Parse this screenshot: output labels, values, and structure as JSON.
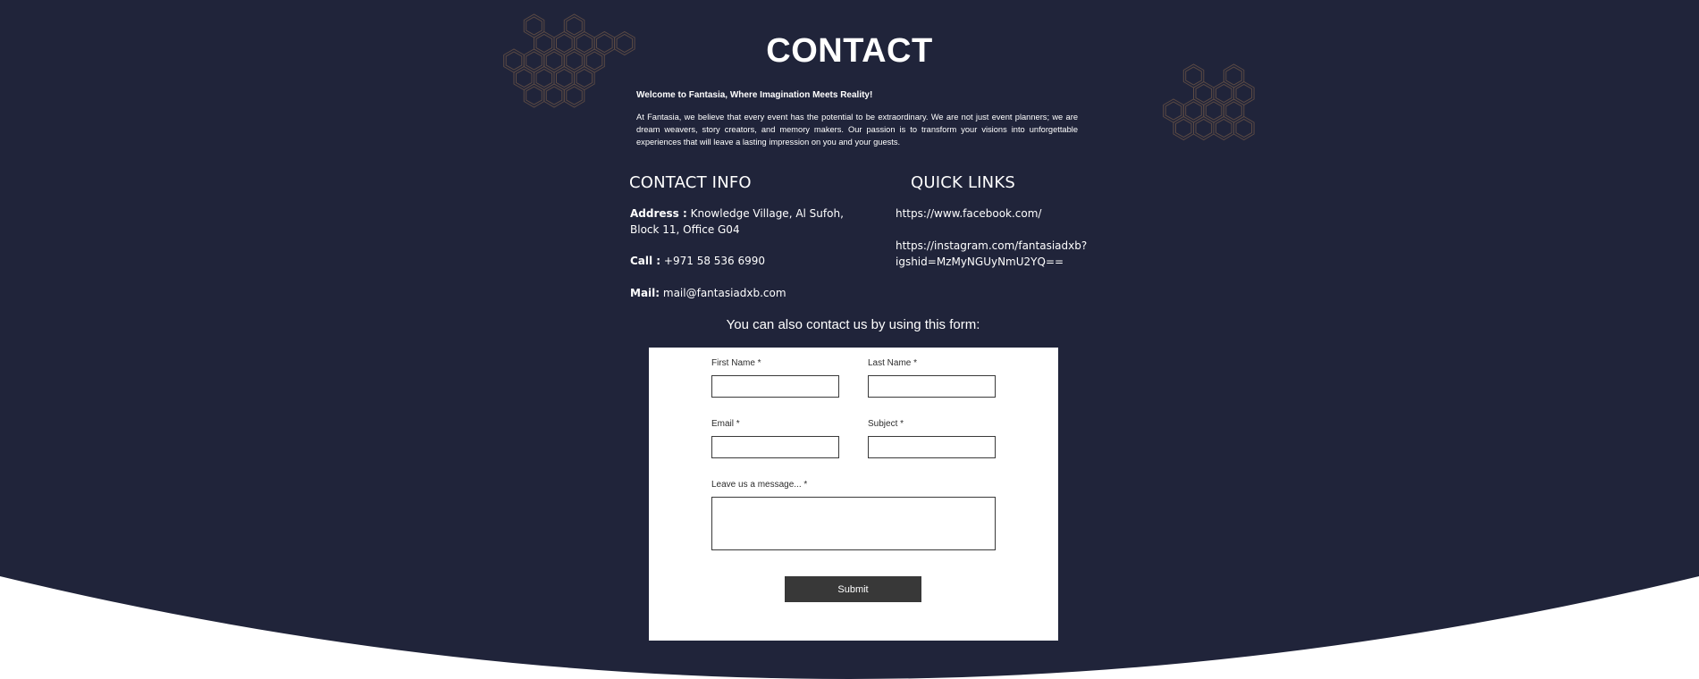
{
  "colors": {
    "background_dark": "#20243a",
    "background_light": "#ffffff",
    "hexagon_stroke": "#5b4a44",
    "button": "#383838"
  },
  "decorations": {
    "left_cluster_icon": "hexagon-pattern-icon",
    "right_cluster_icon": "hexagon-pattern-icon"
  },
  "header": {
    "title": "CONTACT"
  },
  "intro": {
    "heading": "Welcome to Fantasia, Where Imagination Meets Reality!",
    "body": "At Fantasia, we believe that every event has the potential to be extraordinary. We are not just event planners; we are dream weavers, story creators, and memory makers. Our passion is to transform your visions into unforgettable experiences that will leave a lasting impression on you and your guests."
  },
  "contact_info": {
    "heading": "CONTACT INFO",
    "address_label": "Address :",
    "address_line1": " Knowledge Village, Al Sufoh,",
    "address_line2": "Block 11, Office G04",
    "call_label": "Call :",
    "call_value": " +971 58 536 6990",
    "mail_label": "Mail:",
    "mail_value": " mail@fantasiadxb.com"
  },
  "quick_links": {
    "heading": "QUICK LINKS",
    "facebook": "https://www.facebook.com/",
    "instagram_line1": "https://instagram.com/fantasiadxb?",
    "instagram_line2": "igshid=MzMyNGUyNmU2YQ=="
  },
  "form": {
    "intro": "You can also contact us by using this form:",
    "first_name_label": "First Name *",
    "first_name_value": "",
    "last_name_label": "Last Name *",
    "last_name_value": "",
    "email_label": "Email *",
    "email_value": "",
    "subject_label": "Subject *",
    "subject_value": "",
    "message_label": "Leave us a message... *",
    "message_value": "",
    "submit_label": "Submit"
  }
}
